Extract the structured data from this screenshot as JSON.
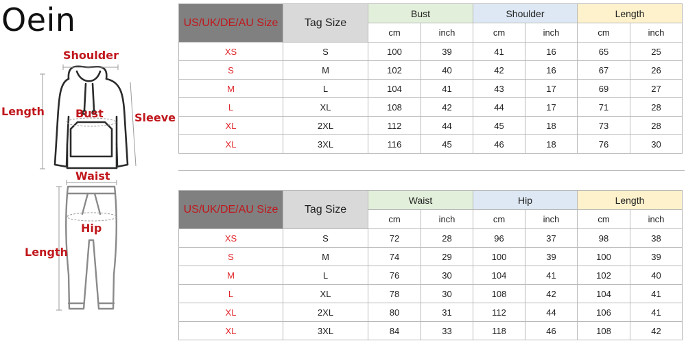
{
  "brand": "Oein",
  "figure": {
    "top_labels": {
      "shoulder": "Shoulder",
      "length": "Length",
      "bust": "Bust",
      "sleeve": "Sleeve"
    },
    "bottom_labels": {
      "waist": "Waist",
      "hip": "Hip",
      "length": "Length"
    }
  },
  "top_table": {
    "size_header": "US/UK/DE/AU Size",
    "tag_header": "Tag Size",
    "groups": [
      "Bust",
      "Shoulder",
      "Length"
    ],
    "units": [
      "cm",
      "inch",
      "cm",
      "inch",
      "cm",
      "inch"
    ],
    "rows": [
      [
        "XS",
        "S",
        "100",
        "39",
        "41",
        "16",
        "65",
        "25"
      ],
      [
        "S",
        "M",
        "102",
        "40",
        "42",
        "16",
        "67",
        "26"
      ],
      [
        "M",
        "L",
        "104",
        "41",
        "43",
        "17",
        "69",
        "27"
      ],
      [
        "L",
        "XL",
        "108",
        "42",
        "44",
        "17",
        "71",
        "28"
      ],
      [
        "XL",
        "2XL",
        "112",
        "44",
        "45",
        "18",
        "73",
        "28"
      ],
      [
        "XL",
        "3XL",
        "116",
        "45",
        "46",
        "18",
        "76",
        "30"
      ]
    ]
  },
  "bottom_table": {
    "size_header": "US/UK/DE/AU Size",
    "tag_header": "Tag Size",
    "groups": [
      "Waist",
      "Hip",
      "Length"
    ],
    "units": [
      "cm",
      "inch",
      "cm",
      "inch",
      "cm",
      "inch"
    ],
    "rows": [
      [
        "XS",
        "S",
        "72",
        "28",
        "96",
        "37",
        "98",
        "38"
      ],
      [
        "S",
        "M",
        "74",
        "29",
        "100",
        "39",
        "100",
        "39"
      ],
      [
        "M",
        "L",
        "76",
        "30",
        "104",
        "41",
        "102",
        "40"
      ],
      [
        "L",
        "XL",
        "78",
        "30",
        "108",
        "42",
        "104",
        "41"
      ],
      [
        "XL",
        "2XL",
        "80",
        "31",
        "112",
        "44",
        "106",
        "41"
      ],
      [
        "XL",
        "3XL",
        "84",
        "33",
        "118",
        "46",
        "108",
        "42"
      ]
    ]
  },
  "colors": {
    "label_red": "#c0171c",
    "size_red": "#e0262b",
    "group1_bg": "#e2efda",
    "group2_bg": "#dde8f4",
    "group3_bg": "#fdf2cc",
    "size_header_bg": "#808080",
    "tag_header_bg": "#d9d9d9"
  }
}
